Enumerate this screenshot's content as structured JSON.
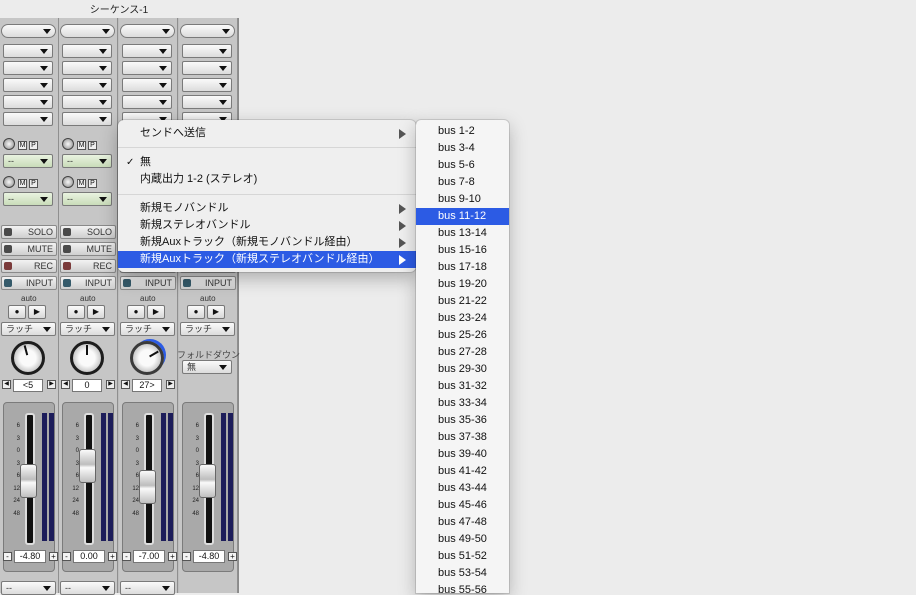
{
  "window": {
    "title": "シーケンス-1"
  },
  "strips": [
    {
      "pan_value": "<5",
      "volume": "-4.80",
      "pan_angle": -15,
      "fader_pos": 0.46,
      "knob_partial": false
    },
    {
      "pan_value": "0",
      "volume": "0.00",
      "pan_angle": 0,
      "fader_pos": 0.33,
      "knob_partial": false
    },
    {
      "pan_value": "27>",
      "volume": "-7.00",
      "pan_angle": 60,
      "fader_pos": 0.52,
      "knob_partial": true
    },
    {
      "pan_value": "",
      "volume": "-4.80",
      "pan_angle": 0,
      "fader_pos": 0.46,
      "knob_partial": false
    }
  ],
  "labels": {
    "solo": "SOLO",
    "mute": "MUTE",
    "rec": "REC",
    "input": "INPUT",
    "auto": "auto",
    "latch": "ラッチ",
    "dash": "--",
    "fold_down": "フォルドダウン",
    "fold_value": "無",
    "m": "M",
    "p": "P",
    "minus": "-",
    "plus": "+"
  },
  "scale_ticks": [
    "6",
    "3",
    "0",
    "3",
    "6",
    "12",
    "24",
    "48"
  ],
  "context_menu": {
    "items": [
      {
        "label": "センドへ送信",
        "submenu": true,
        "checked": false,
        "highlighted": false
      },
      {
        "label": "無",
        "submenu": false,
        "checked": true,
        "highlighted": false
      },
      {
        "label": "内蔵出力 1-2 (ステレオ)",
        "submenu": false,
        "checked": false,
        "highlighted": false
      },
      {
        "label": "新規モノバンドル",
        "submenu": true,
        "checked": false,
        "highlighted": false
      },
      {
        "label": "新規ステレオバンドル",
        "submenu": true,
        "checked": false,
        "highlighted": false
      },
      {
        "label": "新規Auxトラック（新規モノバンドル経由）",
        "submenu": true,
        "checked": false,
        "highlighted": false
      },
      {
        "label": "新規Auxトラック（新規ステレオバンドル経由）",
        "submenu": true,
        "checked": false,
        "highlighted": true
      }
    ],
    "checkmark": "✓"
  },
  "bus_submenu": {
    "highlighted": "bus 11-12",
    "items": [
      "bus 1-2",
      "bus 3-4",
      "bus 5-6",
      "bus 7-8",
      "bus 9-10",
      "bus 11-12",
      "bus 13-14",
      "bus 15-16",
      "bus 17-18",
      "bus 19-20",
      "bus 21-22",
      "bus 23-24",
      "bus 25-26",
      "bus 27-28",
      "bus 29-30",
      "bus 31-32",
      "bus 33-34",
      "bus 35-36",
      "bus 37-38",
      "bus 39-40",
      "bus 41-42",
      "bus 43-44",
      "bus 45-46",
      "bus 47-48",
      "bus 49-50",
      "bus 51-52",
      "bus 53-54",
      "bus 55-56"
    ]
  },
  "colors": {
    "highlight": "#2c5be4",
    "meter": "#1c1c5a",
    "send_green": "#c9dcb9"
  }
}
